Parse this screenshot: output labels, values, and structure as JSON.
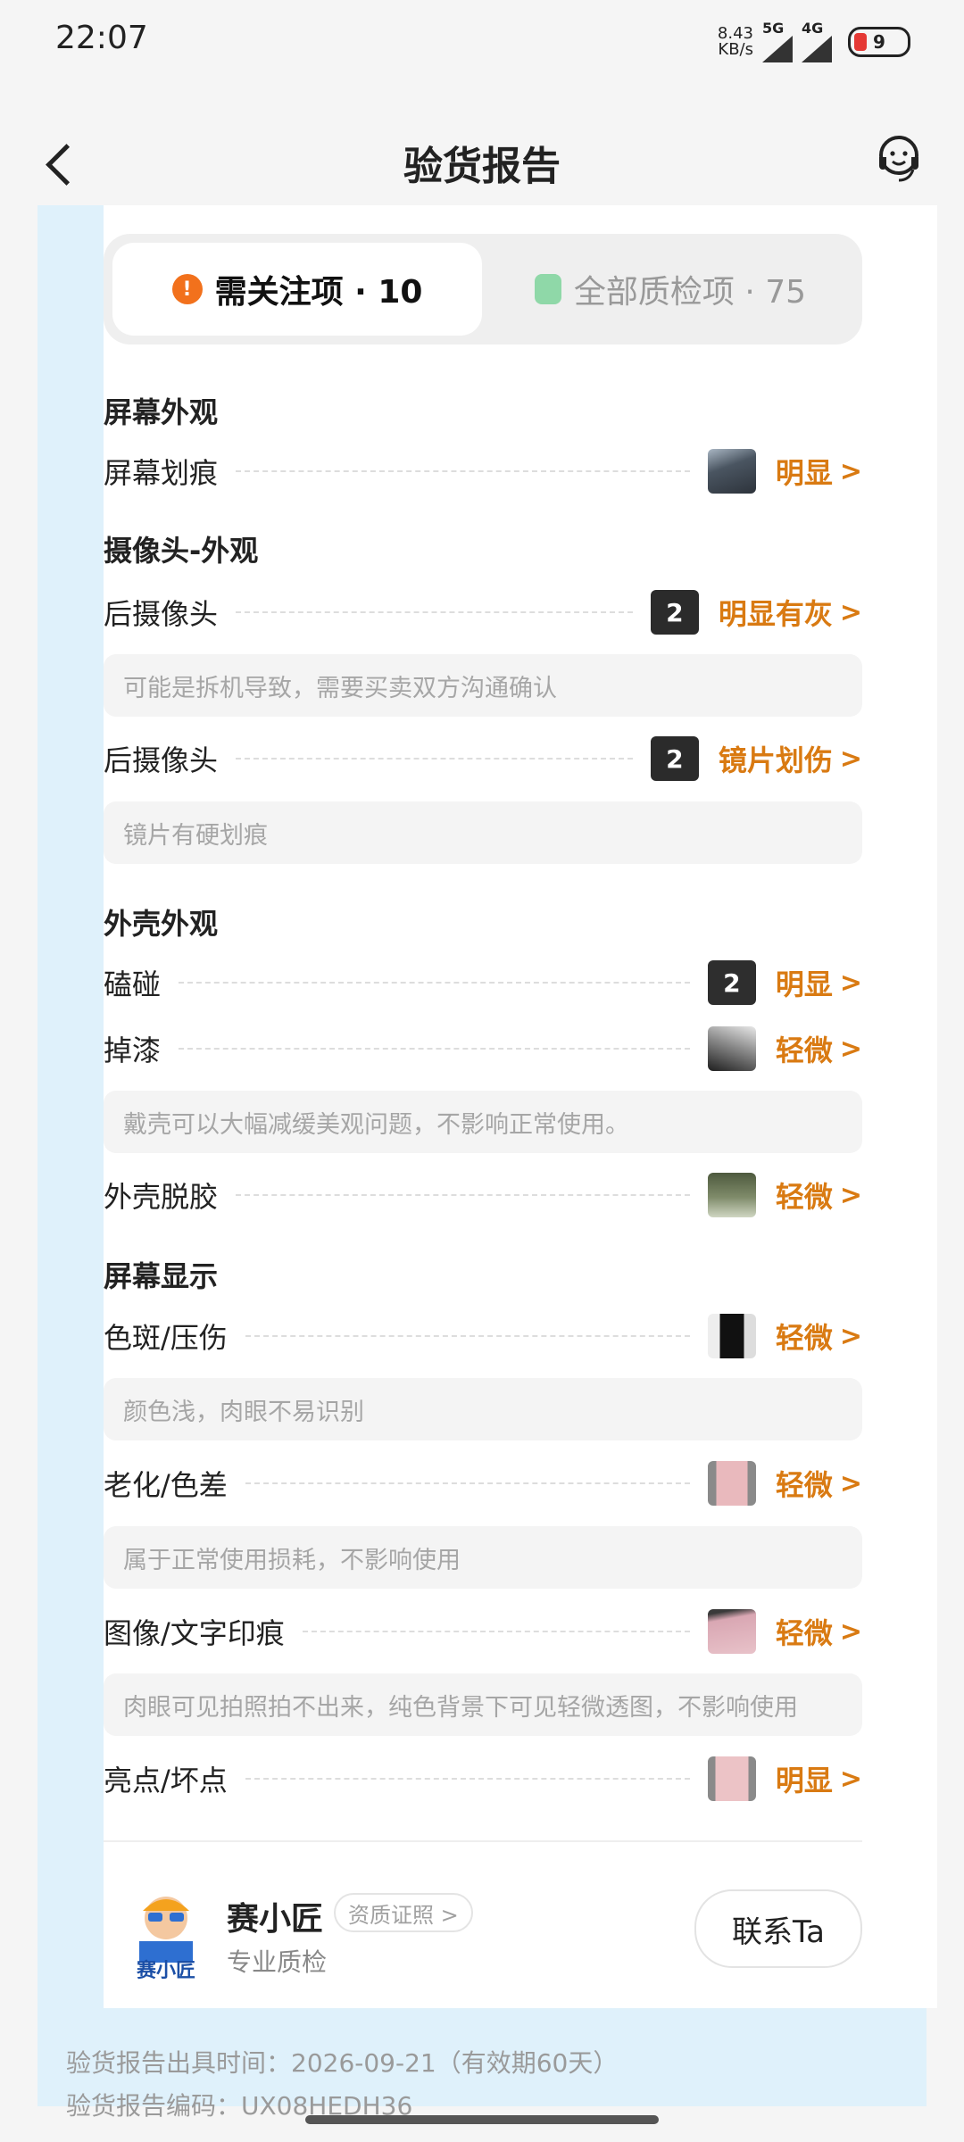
{
  "status_bar": {
    "time": "22:07",
    "net_speed_value": "8.43",
    "net_speed_unit": "KB/s",
    "sig1": "5G",
    "sig2": "4G",
    "battery": "9"
  },
  "header": {
    "title": "验货报告",
    "back_icon": "chevron-left-icon",
    "service_icon": "customer-service-icon"
  },
  "tabs": [
    {
      "label": "需关注项 · 10",
      "icon": "alert-icon",
      "active": true
    },
    {
      "label": "全部质检项 · 75",
      "icon": "document-icon",
      "active": false
    }
  ],
  "sections": {
    "screen_appearance": "屏幕外观",
    "camera_appearance": "摄像头-外观",
    "shell_appearance": "外壳外观",
    "screen_display": "屏幕显示"
  },
  "rows": {
    "screen_scratch": {
      "label": "屏幕划痕",
      "status": "明显",
      "thumb_count": ""
    },
    "rear_camera_1": {
      "label": "后摄像头",
      "status": "明显有灰",
      "thumb_count": "2"
    },
    "rear_camera_2": {
      "label": "后摄像头",
      "status": "镜片划伤",
      "thumb_count": "2"
    },
    "dent": {
      "label": "磕碰",
      "status": "明显",
      "thumb_count": "2"
    },
    "paint_loss": {
      "label": "掉漆",
      "status": "轻微",
      "thumb_count": ""
    },
    "shell_glue": {
      "label": "外壳脱胶",
      "status": "轻微",
      "thumb_count": ""
    },
    "color_spot": {
      "label": "色斑/压伤",
      "status": "轻微",
      "thumb_count": ""
    },
    "aging": {
      "label": "老化/色差",
      "status": "轻微",
      "thumb_count": ""
    },
    "burn_in": {
      "label": "图像/文字印痕",
      "status": "轻微",
      "thumb_count": ""
    },
    "bright_dot": {
      "label": "亮点/坏点",
      "status": "明显",
      "thumb_count": ""
    }
  },
  "notes": {
    "rear_camera_1": "可能是拆机导致，需要买卖双方沟通确认",
    "rear_camera_2": "镜片有硬划痕",
    "paint_loss": "戴壳可以大幅减缓美观问题，不影响正常使用。",
    "color_spot": "颜色浅，肉眼不易识别",
    "aging": "属于正常使用损耗，不影响使用",
    "burn_in": "肉眼可见拍照拍不出来，纯色背景下可见轻微透图，不影响使用"
  },
  "chevron": ">",
  "inspector": {
    "name": "赛小匠",
    "cert_label": "资质证照 >",
    "role": "专业质检",
    "contact_label": "联系Ta",
    "logo_text": "赛小匠"
  },
  "footer": {
    "issued": "验货报告出具时间：2026-09-21（有效期60天）",
    "report_no": "验货报告编码：UX08HEDH36"
  },
  "colors": {
    "accent_orange": "#d97a12",
    "warn_icon": "#f2711c",
    "frame_blue": "#dff1fb"
  }
}
